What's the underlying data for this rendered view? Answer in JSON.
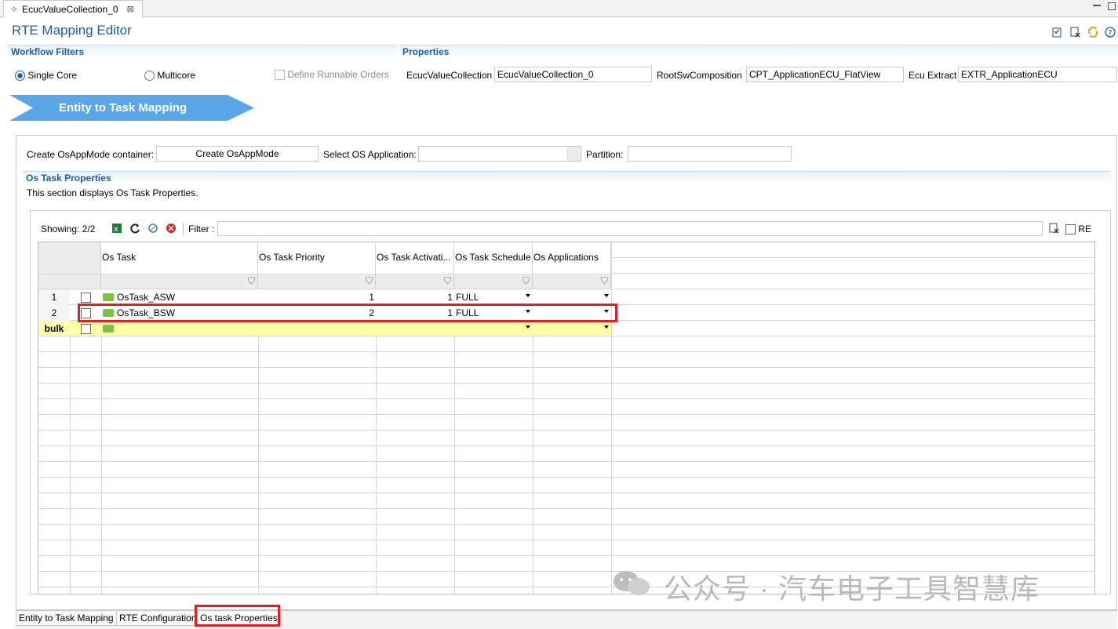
{
  "tab": {
    "title": "EcucValueCollection_0",
    "close": "⊠"
  },
  "header": {
    "title": "RTE Mapping Editor"
  },
  "workflow": {
    "section_title": "Workflow Filters",
    "single_core": "Single Core",
    "multicore": "Multicore",
    "define_runnable": "Define Runnable Orders"
  },
  "properties": {
    "section_title": "Properties",
    "ecuc_label": "EcucValueCollection",
    "ecuc_value": "EcucValueCollection_0",
    "root_label": "RootSwComposition",
    "root_value": "CPT_ApplicationECU_FlatView",
    "extract_label": "Ecu Extract",
    "extract_value": "EXTR_ApplicationECU"
  },
  "step": {
    "label": "Entity to Task Mapping"
  },
  "controls": {
    "osappmode_label": "Create OsAppMode container:",
    "osappmode_button": "Create OsAppMode",
    "os_app_label": "Select OS Application:",
    "os_app_value": "",
    "partition_label": "Partition:",
    "partition_value": ""
  },
  "os_task_section": {
    "title": "Os Task Properties",
    "description": "This section displays Os Task Properties."
  },
  "toolbar": {
    "showing": "Showing: 2/2",
    "filter_label": "Filter :",
    "filter_value": "",
    "re_label": "RE"
  },
  "table": {
    "columns": [
      "Os Task",
      "Os Task Priority",
      "Os Task Activati...",
      "Os Task Schedule",
      "Os Applications"
    ],
    "rows": [
      {
        "index": "1",
        "task": "OsTask_ASW",
        "priority": "1",
        "activation": "1",
        "schedule": "FULL",
        "applications": ""
      },
      {
        "index": "2",
        "task": "OsTask_BSW",
        "priority": "2",
        "activation": "1",
        "schedule": "FULL",
        "applications": ""
      }
    ],
    "bulk_label": "bulk"
  },
  "bottom_tabs": [
    "Entity to Task Mapping",
    "RTE Configuration",
    "Os task Properties"
  ],
  "watermark": "公众号 · 汽车电子工具智慧库",
  "colors": {
    "accent": "#1a5fa8",
    "arrow": "#5aa6e6",
    "highlight": "#e02020",
    "bulk_row": "#ffffa8",
    "folder": "#7cc243"
  }
}
